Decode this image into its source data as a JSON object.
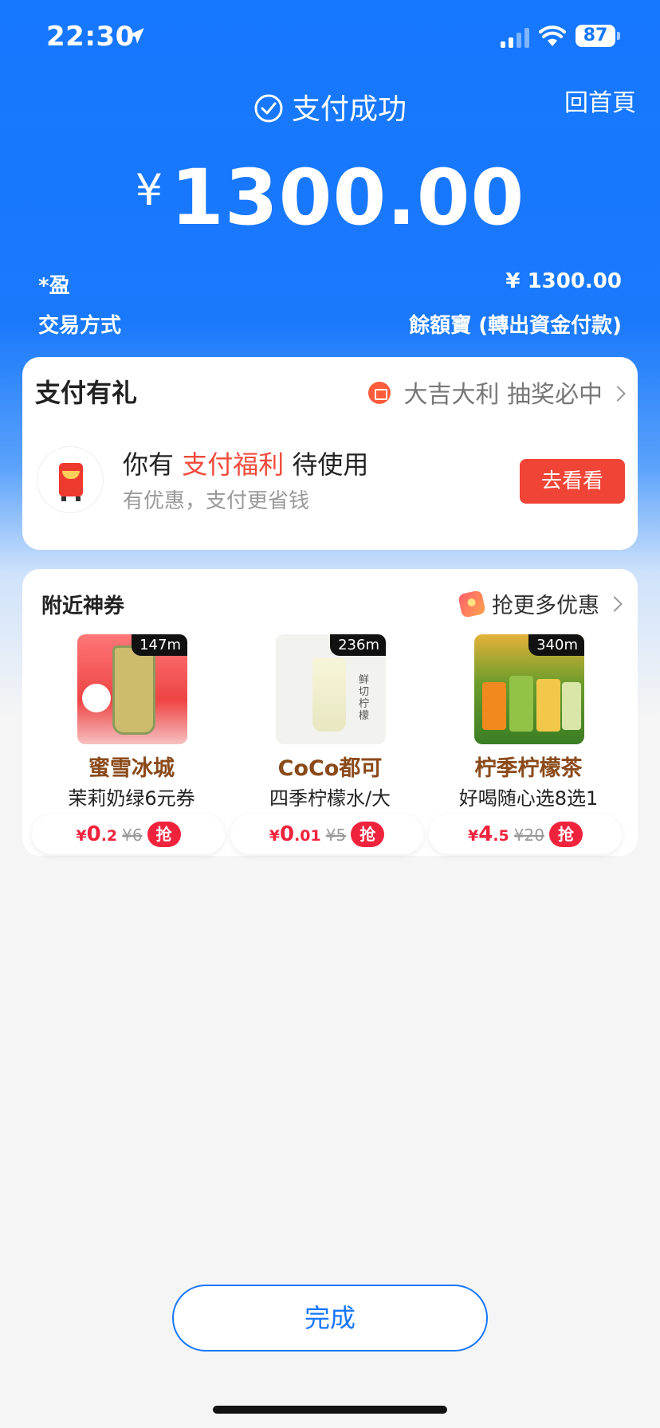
{
  "status_bar": {
    "time": "22:30",
    "battery": "87"
  },
  "header": {
    "status_text": "支付成功",
    "home_link": "回首頁",
    "currency": "¥",
    "amount": "1300.00"
  },
  "details": {
    "payee": "*盈",
    "payee_amount": "¥ 1300.00",
    "method_label": "交易方式",
    "method_value": "餘額寶 (轉出資金付款)"
  },
  "gift_card": {
    "title": "支付有礼",
    "promo": "大吉大利 抽奖必中",
    "line1_prefix": "你有 ",
    "line1_highlight": "支付福利",
    "line1_suffix": " 待使用",
    "line2": "有优惠，支付更省钱",
    "button": "去看看"
  },
  "coupons_card": {
    "title": "附近神券",
    "more": "抢更多优惠",
    "items": [
      {
        "distance": "147m",
        "name": "蜜雪冰城",
        "desc": "茉莉奶绿6元券",
        "currency": "¥",
        "price_int": "0",
        "price_dec": ".2",
        "original": "¥6",
        "grab": "抢"
      },
      {
        "distance": "236m",
        "name": "CoCo都可",
        "desc": "四季柠檬水/大",
        "currency": "¥",
        "price_int": "0",
        "price_dec": ".01",
        "original": "¥5",
        "grab": "抢",
        "image_text": "鲜切柠檬"
      },
      {
        "distance": "340m",
        "name": "柠季柠檬茶",
        "desc": "好喝随心选8选1",
        "currency": "¥",
        "price_int": "4",
        "price_dec": ".5",
        "original": "¥20",
        "grab": "抢"
      }
    ]
  },
  "footer": {
    "done_button": "完成"
  },
  "colors": {
    "brand_blue": "#1677ff",
    "accent_red": "#ef4436",
    "price_red": "#f0233d"
  }
}
